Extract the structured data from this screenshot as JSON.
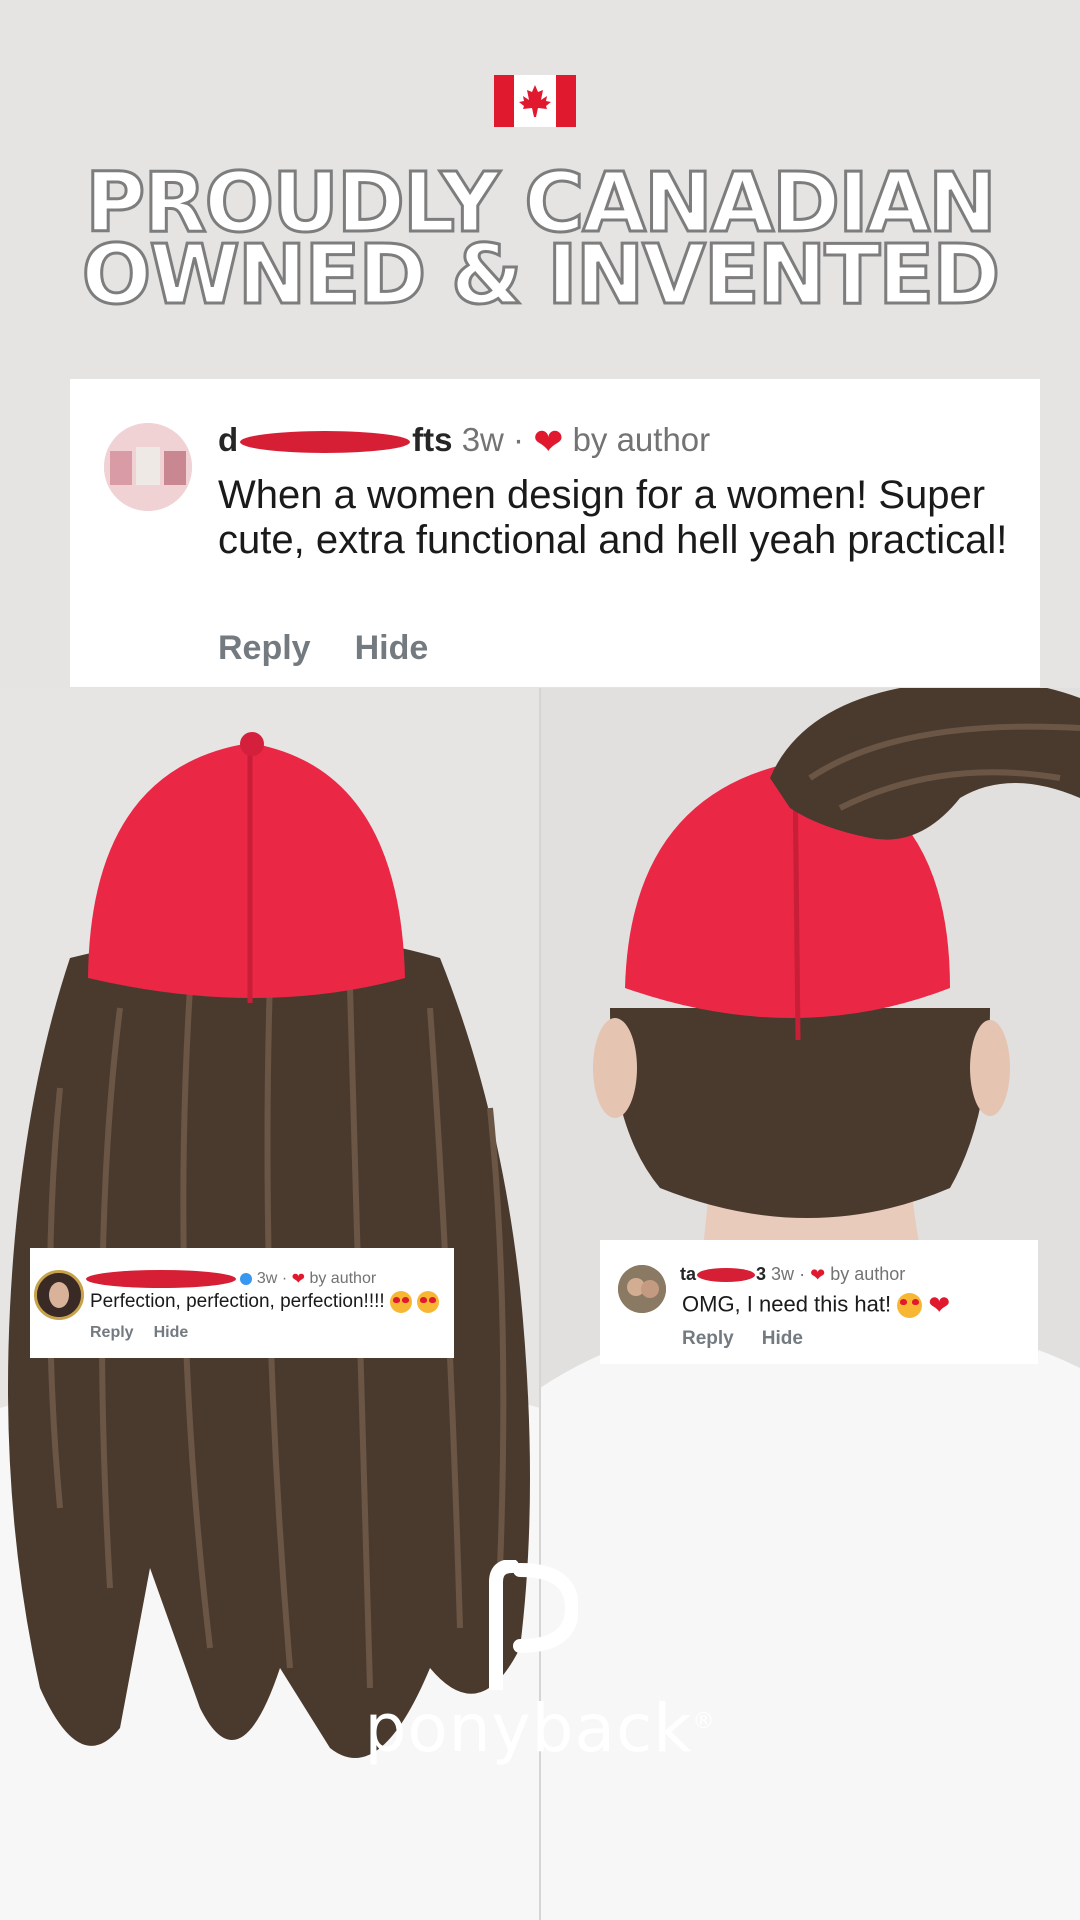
{
  "headline": {
    "line1": "PROUDLY CANADIAN",
    "line2": "OWNED & INVENTED"
  },
  "flag_icon": "canada-flag-icon",
  "comments": [
    {
      "username_visible_start": "d",
      "username_visible_end": "fts",
      "time": "3w",
      "separator": "·",
      "liked_by": "by author",
      "text": "When a women design for a women! Super cute, extra functional and hell yeah practical!",
      "reply": "Reply",
      "hide": "Hide"
    },
    {
      "time": "3w",
      "separator": "·",
      "liked_by": "by author",
      "text": "Perfection, perfection, perfection!!!!",
      "reply": "Reply",
      "hide": "Hide"
    },
    {
      "username_visible_start": "ta",
      "username_visible_end": "3",
      "time": "3w",
      "separator": "·",
      "liked_by": "by author",
      "text": "OMG, I need this hat!",
      "reply": "Reply",
      "hide": "Hide"
    }
  ],
  "brand": {
    "name": "ponyback",
    "mark": "®"
  },
  "colors": {
    "background": "#e5e4e3",
    "cap_red": "#ea2745",
    "heart_red": "#e0192f",
    "redaction": "#d61f35",
    "hair_brown": "#4a3a2e"
  }
}
